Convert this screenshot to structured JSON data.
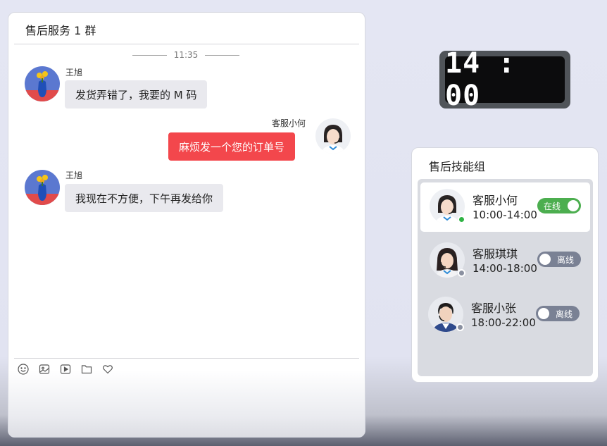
{
  "chat": {
    "title": "售后服务 1 群",
    "time_divider": "11:35",
    "messages": [
      {
        "sender": "王旭",
        "text": "发货弄错了，我要的 M 码",
        "direction": "in"
      },
      {
        "sender": "客服小何",
        "text": "麻烦发一个您的订单号",
        "direction": "out"
      },
      {
        "sender": "王旭",
        "text": "我现在不方便，下午再发给你",
        "direction": "in"
      }
    ],
    "toolbar_icons": [
      "emoji-icon",
      "image-icon",
      "video-icon",
      "folder-icon",
      "heart-icon"
    ]
  },
  "clock": {
    "time": "14 : 00"
  },
  "skill_group": {
    "title": "售后技能组",
    "agents": [
      {
        "name": "客服小何",
        "hours": "10:00-14:00",
        "status": "在线",
        "online": true
      },
      {
        "name": "客服琪琪",
        "hours": "14:00-18:00",
        "status": "离线",
        "online": false
      },
      {
        "name": "客服小张",
        "hours": "18:00-22:00",
        "status": "离线",
        "online": false
      }
    ]
  },
  "colors": {
    "accent_red": "#f3474c",
    "online_green": "#4cae4f",
    "offline_gray": "#7a8194"
  }
}
